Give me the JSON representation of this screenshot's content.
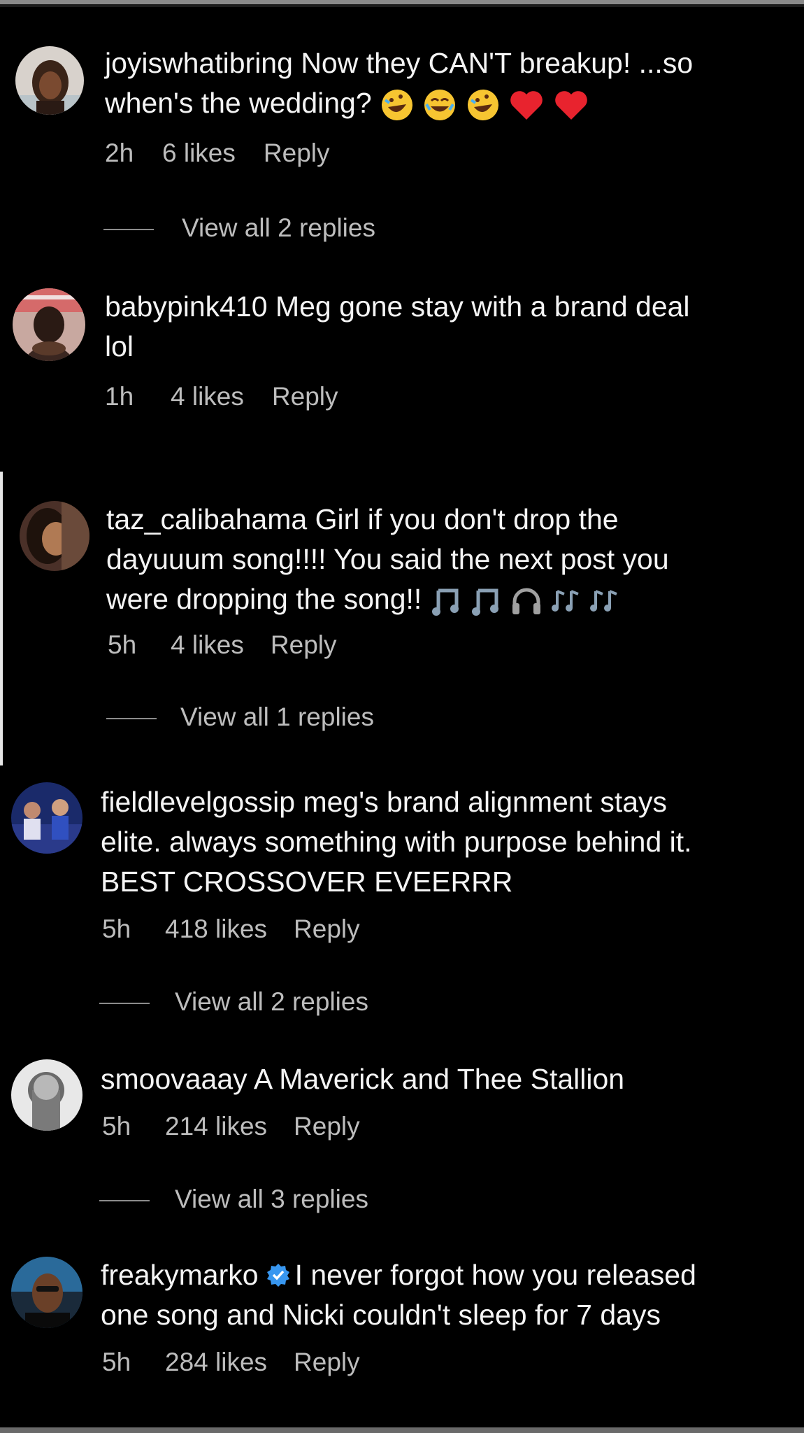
{
  "comments": [
    {
      "username": "joyiswhatibring",
      "line1": "Now they CAN'T breakup! ...so",
      "line2": "when's the wedding?",
      "time": "2h",
      "likes": "6 likes",
      "reply": "Reply",
      "view_replies": "View all 2 replies"
    },
    {
      "username": "babypink410",
      "line1": "Meg gone stay with a brand deal",
      "line2": "lol",
      "time": "1h",
      "likes": "4 likes",
      "reply": "Reply"
    },
    {
      "username": "taz_calibahama",
      "line1": "Girl if you don't drop the",
      "line2": "dayuuum song!!!! You said the next post you",
      "line3": "were dropping the song!!",
      "time": "5h",
      "likes": "4 likes",
      "reply": "Reply",
      "view_replies": "View all 1 replies"
    },
    {
      "username": "fieldlevelgossip",
      "line1": "meg's brand alignment stays",
      "line2": "elite. always something with purpose behind it.",
      "line3": "BEST CROSSOVER EVEERRR",
      "time": "5h",
      "likes": "418 likes",
      "reply": "Reply",
      "view_replies": "View all 2 replies"
    },
    {
      "username": "smoovaaay",
      "line1": "A Maverick and Thee Stallion",
      "time": "5h",
      "likes": "214 likes",
      "reply": "Reply",
      "view_replies": "View all 3 replies"
    },
    {
      "username": "freakymarko",
      "line1": "I never forgot how you released",
      "line2": "one song and Nicki couldn't sleep for 7 days",
      "time": "5h",
      "likes": "284 likes",
      "reply": "Reply"
    }
  ],
  "colors": {
    "background": "#000000",
    "text": "#f4f4f4",
    "meta": "#bdbdbd",
    "verified": "#3897f0",
    "heart": "#e8232e"
  }
}
